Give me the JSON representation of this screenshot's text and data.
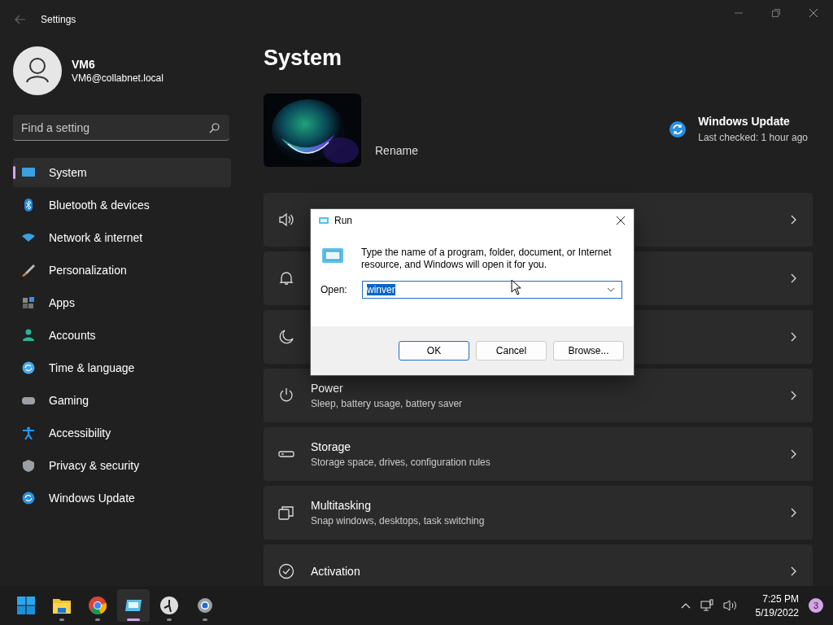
{
  "window": {
    "title": "Settings"
  },
  "user": {
    "name": "VM6",
    "email": "VM6@collabnet.local"
  },
  "search": {
    "placeholder": "Find a setting"
  },
  "nav": [
    {
      "label": "System",
      "selected": true
    },
    {
      "label": "Bluetooth & devices",
      "selected": false
    },
    {
      "label": "Network & internet",
      "selected": false
    },
    {
      "label": "Personalization",
      "selected": false
    },
    {
      "label": "Apps",
      "selected": false
    },
    {
      "label": "Accounts",
      "selected": false
    },
    {
      "label": "Time & language",
      "selected": false
    },
    {
      "label": "Gaming",
      "selected": false
    },
    {
      "label": "Accessibility",
      "selected": false
    },
    {
      "label": "Privacy & security",
      "selected": false
    },
    {
      "label": "Windows Update",
      "selected": false
    }
  ],
  "page": {
    "title": "System",
    "device_action": "Rename",
    "update": {
      "title": "Windows Update",
      "status": "Last checked: 1 hour ago"
    },
    "cards": [
      {
        "kind": "covered"
      },
      {
        "kind": "covered"
      },
      {
        "kind": "covered"
      },
      {
        "kind": "setting",
        "title": "Power",
        "subtitle": "Sleep, battery usage, battery saver"
      },
      {
        "kind": "setting",
        "title": "Storage",
        "subtitle": "Storage space, drives, configuration rules"
      },
      {
        "kind": "setting",
        "title": "Multitasking",
        "subtitle": "Snap windows, desktops, task switching"
      },
      {
        "kind": "setting",
        "title": "Activation"
      }
    ]
  },
  "run_dialog": {
    "title": "Run",
    "message": "Type the name of a program, folder, document, or Internet resource, and Windows will open it for you.",
    "open_label": "Open:",
    "value": "winver",
    "buttons": [
      {
        "label": "OK",
        "default": true
      },
      {
        "label": "Cancel",
        "default": false
      },
      {
        "label": "Browse...",
        "default": false
      }
    ]
  },
  "taskbar": {
    "apps": [
      {
        "active": false
      },
      {
        "active": false
      },
      {
        "active": false
      },
      {
        "active": true
      },
      {
        "active": false
      },
      {
        "active": false
      }
    ],
    "time": "7:25 PM",
    "date": "5/19/2022",
    "notifications": "3"
  }
}
